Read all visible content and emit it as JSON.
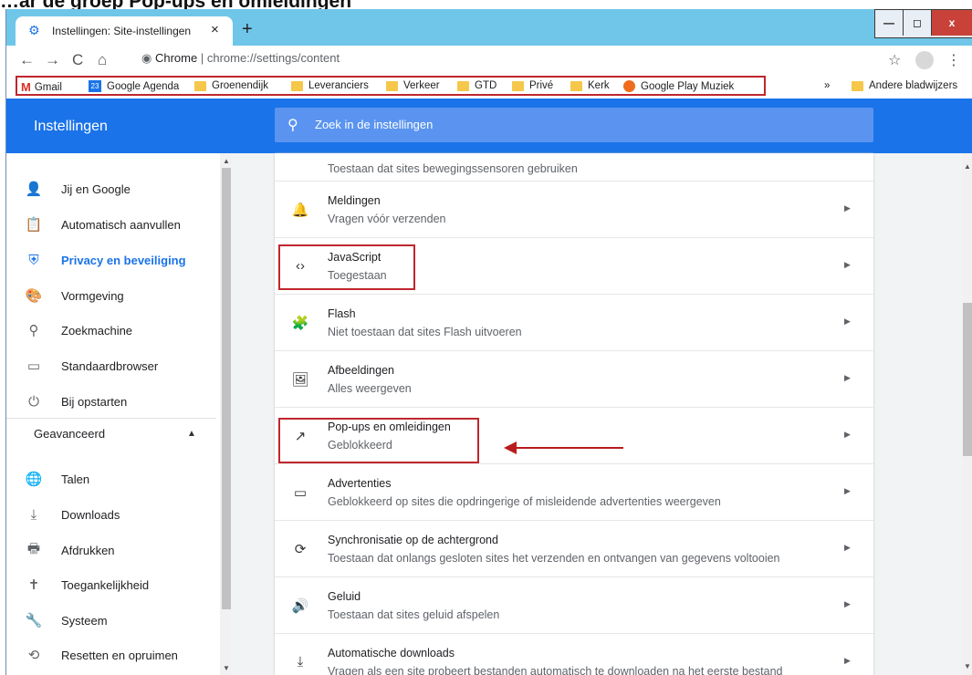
{
  "doc_heading": "…ar de groep Pop-ups en omleidingen",
  "tab": {
    "title": "Instellingen: Site-instellingen",
    "close": "×",
    "newtab": "+"
  },
  "window_buttons": {
    "minimize": "—",
    "maximize": "◻",
    "close": "x"
  },
  "toolbar": {
    "back": "←",
    "forward": "→",
    "reload": "C",
    "home": "⌂",
    "site_name": "Chrome",
    "separator": "|",
    "url": "chrome://settings/content",
    "star": "☆",
    "menu": "⋮"
  },
  "bookmarks": [
    {
      "label": "Gmail",
      "icon": "gmail-icon"
    },
    {
      "label": "Google Agenda",
      "icon": "calendar-icon",
      "icon_text": "23"
    },
    {
      "label": "Groenendijk",
      "icon": "folder-icon"
    },
    {
      "label": "Leveranciers",
      "icon": "folder-icon"
    },
    {
      "label": "Verkeer",
      "icon": "folder-icon"
    },
    {
      "label": "GTD",
      "icon": "folder-icon"
    },
    {
      "label": "Privé",
      "icon": "folder-icon"
    },
    {
      "label": "Kerk",
      "icon": "folder-icon"
    },
    {
      "label": "Google Play Muziek",
      "icon": "play-music-icon"
    }
  ],
  "bookmarks_overflow": "»",
  "other_bookmarks": "Andere bladwijzers",
  "header": {
    "title": "Instellingen",
    "search_placeholder": "Zoek in de instellingen"
  },
  "sidebar": {
    "items": [
      {
        "label": "Jij en Google",
        "icon": "person-icon",
        "glyph": "👤"
      },
      {
        "label": "Automatisch aanvullen",
        "icon": "clipboard-icon",
        "glyph": "📋"
      },
      {
        "label": "Privacy en beveiliging",
        "icon": "shield-icon",
        "glyph": "⛨",
        "active": true
      },
      {
        "label": "Vormgeving",
        "icon": "palette-icon",
        "glyph": "🎨"
      },
      {
        "label": "Zoekmachine",
        "icon": "search-icon",
        "glyph": "⚲"
      },
      {
        "label": "Standaardbrowser",
        "icon": "browser-icon",
        "glyph": "▭"
      },
      {
        "label": "Bij opstarten",
        "icon": "power-icon",
        "glyph": "⏻"
      }
    ],
    "advanced_label": "Geavanceerd",
    "advanced_caret": "▲",
    "advanced_items": [
      {
        "label": "Talen",
        "icon": "globe-icon",
        "glyph": "🌐"
      },
      {
        "label": "Downloads",
        "icon": "download-icon",
        "glyph": "⤓"
      },
      {
        "label": "Afdrukken",
        "icon": "printer-icon",
        "glyph": "🖶"
      },
      {
        "label": "Toegankelijkheid",
        "icon": "accessibility-icon",
        "glyph": "✝"
      },
      {
        "label": "Systeem",
        "icon": "wrench-icon",
        "glyph": "🔧"
      },
      {
        "label": "Resetten en opruimen",
        "icon": "history-icon",
        "glyph": "⟲"
      }
    ]
  },
  "content": {
    "cut_top_text": "Toestaan dat sites bewegingssensoren gebruiken",
    "rows": [
      {
        "title": "Meldingen",
        "subtitle": "Vragen vóór verzenden",
        "icon": "bell-icon",
        "glyph": "🔔"
      },
      {
        "title": "JavaScript",
        "subtitle": "Toegestaan",
        "icon": "code-icon",
        "glyph": "‹›"
      },
      {
        "title": "Flash",
        "subtitle": "Niet toestaan dat sites Flash uitvoeren",
        "icon": "puzzle-icon",
        "glyph": "🧩"
      },
      {
        "title": "Afbeeldingen",
        "subtitle": "Alles weergeven",
        "icon": "image-icon",
        "glyph": "🖼"
      },
      {
        "title": "Pop-ups en omleidingen",
        "subtitle": "Geblokkeerd",
        "icon": "open-in-new-icon",
        "glyph": "↗"
      },
      {
        "title": "Advertenties",
        "subtitle": "Geblokkeerd op sites die opdringerige of misleidende advertenties weergeven",
        "icon": "ad-icon",
        "glyph": "▭"
      },
      {
        "title": "Synchronisatie op de achtergrond",
        "subtitle": "Toestaan dat onlangs gesloten sites het verzenden en ontvangen van gegevens voltooien",
        "icon": "sync-icon",
        "glyph": "⟳"
      },
      {
        "title": "Geluid",
        "subtitle": "Toestaan dat sites geluid afspelen",
        "icon": "volume-icon",
        "glyph": "🔊"
      },
      {
        "title": "Automatische downloads",
        "subtitle": "Vragen als een site probeert bestanden automatisch te downloaden na het eerste bestand",
        "icon": "download-icon",
        "glyph": "⤓"
      }
    ],
    "row_arrow": "▶"
  },
  "colors": {
    "accent": "#1a73e8",
    "annotation_red": "#c0262d",
    "titlebar": "#6fc6e9"
  }
}
